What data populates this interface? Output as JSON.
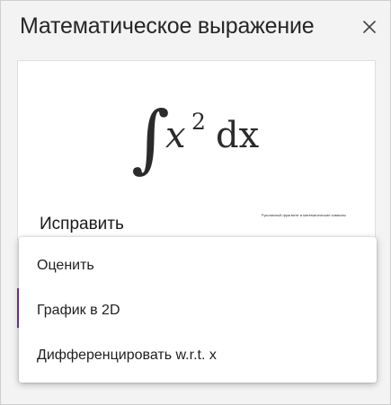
{
  "pane": {
    "title": "Математическое выражение",
    "close_icon": "close-icon"
  },
  "equation": {
    "integral_symbol": "∫",
    "base": "x",
    "exponent": "2",
    "differential": "dx"
  },
  "fix": {
    "label": "Исправить",
    "ink_caption": "Рукописный фрагмент в математические символы"
  },
  "menu": {
    "items": [
      {
        "label": "Оценить"
      },
      {
        "label": "График в 2D"
      },
      {
        "label": "Дифференцировать w.r.t. x"
      }
    ]
  },
  "colors": {
    "pane_background": "#f3f3f3",
    "card_background": "#ffffff",
    "accent": "#7b3a96",
    "text": "#262626"
  }
}
